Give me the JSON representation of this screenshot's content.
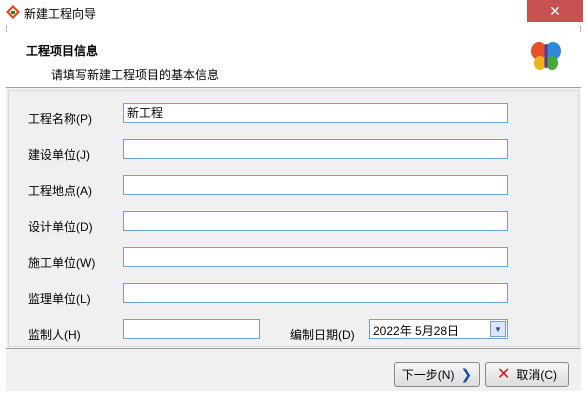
{
  "window": {
    "title": "新建工程向导",
    "close_glyph": "✕"
  },
  "header": {
    "title": "工程项目信息",
    "subtitle": "请填写新建工程项目的基本信息"
  },
  "form": {
    "fields": [
      {
        "label": "工程名称(P)",
        "value": ""
      },
      {
        "label": "建设单位(J)",
        "value": ""
      },
      {
        "label": "工程地点(A)",
        "value": ""
      },
      {
        "label": "设计单位(D)",
        "value": ""
      },
      {
        "label": "施工单位(W)",
        "value": ""
      },
      {
        "label": "监理单位(L)",
        "value": ""
      }
    ],
    "project_name_value": "新工程",
    "supervisor": {
      "label": "监制人(H)",
      "value": ""
    },
    "date": {
      "label": "编制日期(D)",
      "value": "2022年 5月28日"
    }
  },
  "buttons": {
    "next": "下一步(N)",
    "cancel": "取消(C)"
  },
  "icons": {
    "app": "app-window-icon",
    "logo": "butterfly-logo-icon",
    "next": "chevron-right-icon",
    "cancel": "red-x-icon",
    "dropdown": "dropdown-arrow-icon"
  }
}
